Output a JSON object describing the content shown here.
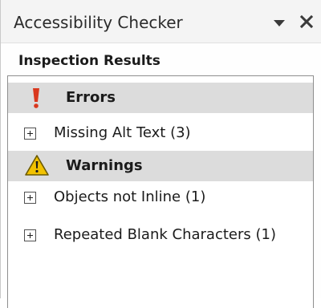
{
  "pane": {
    "title": "Accessibility Checker",
    "dropdown_icon": "dropdown-triangle-icon",
    "close_icon": "close-x-icon"
  },
  "results": {
    "heading": "Inspection Results",
    "groups": [
      {
        "label": "Errors",
        "icon": "exclamation-icon",
        "color": "#d9381e",
        "items": [
          {
            "label": "Missing Alt Text (3)",
            "expanded": false
          }
        ]
      },
      {
        "label": "Warnings",
        "icon": "warning-triangle-icon",
        "color": "#f2c200",
        "items": [
          {
            "label": "Objects not Inline (1)",
            "expanded": false
          },
          {
            "label": "Repeated Blank Characters (1)",
            "expanded": false
          }
        ]
      }
    ]
  }
}
